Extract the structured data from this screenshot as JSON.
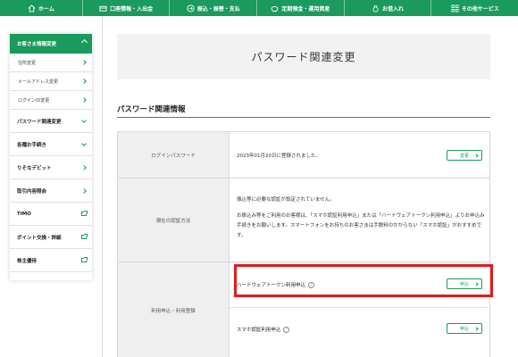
{
  "topnav": [
    {
      "label": "ホーム",
      "icon": "home-icon"
    },
    {
      "label": "口座情報・入出金",
      "icon": "card-icon"
    },
    {
      "label": "振込・振替・支払",
      "icon": "transfer-icon"
    },
    {
      "label": "定期預金・運用資産",
      "icon": "piggy-icon"
    },
    {
      "label": "お借入れ",
      "icon": "moneybag-icon"
    },
    {
      "label": "その他サービス",
      "icon": "grid-icon"
    }
  ],
  "sidebar": {
    "header": "お客さま情報変更",
    "subitems": [
      "住所変更",
      "メールアドレス変更",
      "ログインID変更"
    ],
    "items": [
      {
        "label": "パスワード関連変更",
        "type": "down"
      },
      {
        "label": "各種お手続き",
        "type": "down"
      },
      {
        "label": "りそなデビット",
        "type": "right"
      },
      {
        "label": "取引内容照会",
        "type": "right"
      },
      {
        "label": "TIMO",
        "type": "ext"
      },
      {
        "label": "ポイント交換・詳細",
        "type": "ext"
      },
      {
        "label": "株主優待",
        "type": "ext"
      }
    ]
  },
  "page": {
    "title": "パスワード関連変更",
    "section_title": "パスワード関連情報"
  },
  "table": {
    "login_password": {
      "label": "ログインパスワード",
      "value": "2023年01月20日に登録されました。",
      "button": "変更"
    },
    "auth_method": {
      "label": "現在の認証方法",
      "line1": "振込等に必要な認証が設定されていません。",
      "line2": "お振込み等をご利用のお客様は、「スマホ認証利用申込」または「ハードウェアトークン利用申込」よりお申込み手続きをお願いします。スマートフォンをお持ちのお客さまは手数料のかからない「スマホ認証」がおすすめです。"
    },
    "apply": {
      "label": "利用申込・利用登録",
      "hardware_token": "ハードウェアトークン利用申込",
      "smartphone_auth": "スマホ認証利用申込",
      "button": "申込",
      "help": "?"
    }
  },
  "colors": {
    "brand_green": "#1a9a5c",
    "highlight_red": "#e21b1b"
  }
}
